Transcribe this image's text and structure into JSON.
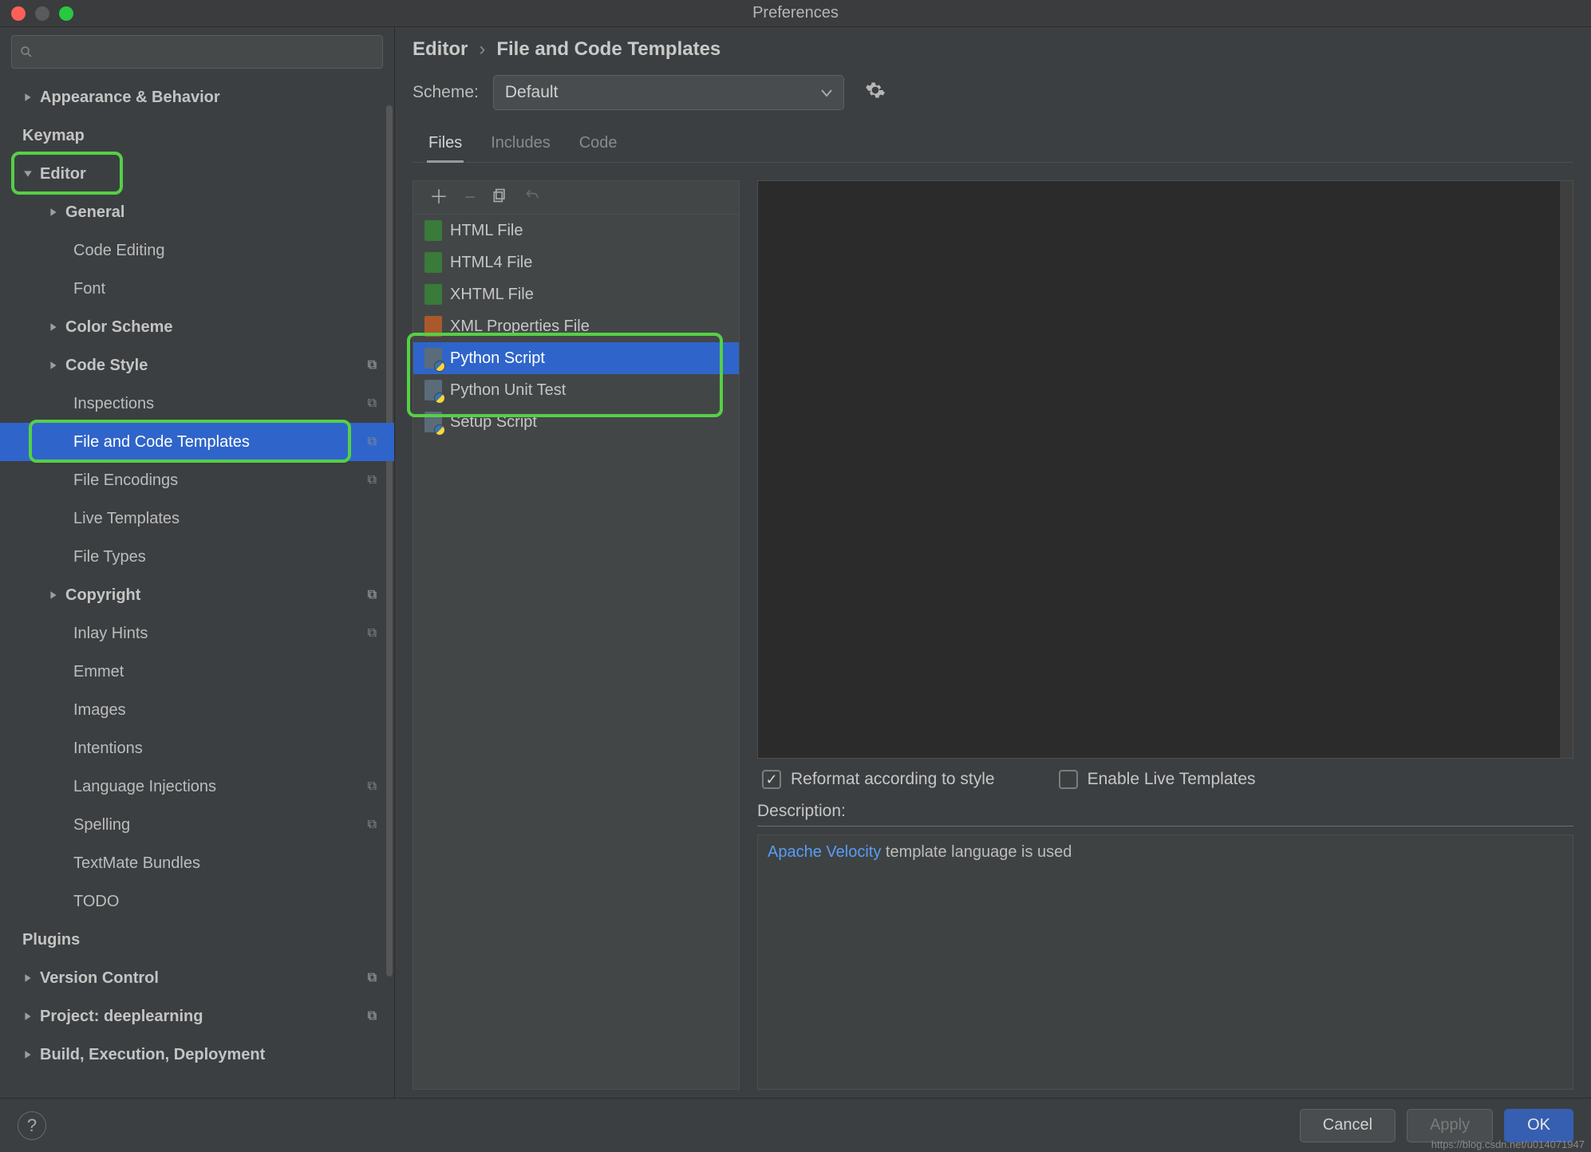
{
  "window": {
    "title": "Preferences"
  },
  "search": {
    "placeholder": ""
  },
  "sidebar": {
    "items": [
      {
        "label": "Appearance & Behavior",
        "level": 0,
        "arrow": "right"
      },
      {
        "label": "Keymap",
        "level": 0
      },
      {
        "label": "Editor",
        "level": 0,
        "arrow": "down",
        "highlight": true
      },
      {
        "label": "General",
        "level": 1,
        "arrow": "right"
      },
      {
        "label": "Code Editing",
        "level": 2
      },
      {
        "label": "Font",
        "level": 2
      },
      {
        "label": "Color Scheme",
        "level": 1,
        "arrow": "right"
      },
      {
        "label": "Code Style",
        "level": 1,
        "arrow": "right",
        "override": true
      },
      {
        "label": "Inspections",
        "level": 2,
        "override": true
      },
      {
        "label": "File and Code Templates",
        "level": 2,
        "selected": true,
        "override": true,
        "highlight": true
      },
      {
        "label": "File Encodings",
        "level": 2,
        "override": true
      },
      {
        "label": "Live Templates",
        "level": 2
      },
      {
        "label": "File Types",
        "level": 2
      },
      {
        "label": "Copyright",
        "level": 1,
        "arrow": "right",
        "override": true
      },
      {
        "label": "Inlay Hints",
        "level": 2,
        "override": true
      },
      {
        "label": "Emmet",
        "level": 2
      },
      {
        "label": "Images",
        "level": 2
      },
      {
        "label": "Intentions",
        "level": 2
      },
      {
        "label": "Language Injections",
        "level": 2,
        "override": true
      },
      {
        "label": "Spelling",
        "level": 2,
        "override": true
      },
      {
        "label": "TextMate Bundles",
        "level": 2
      },
      {
        "label": "TODO",
        "level": 2
      },
      {
        "label": "Plugins",
        "level": 0
      },
      {
        "label": "Version Control",
        "level": 0,
        "arrow": "right",
        "override": true
      },
      {
        "label": "Project: deeplearning",
        "level": 0,
        "arrow": "right",
        "override": true
      },
      {
        "label": "Build, Execution, Deployment",
        "level": 0,
        "arrow": "right"
      }
    ]
  },
  "breadcrumb": {
    "a": "Editor",
    "b": "File and Code Templates"
  },
  "scheme": {
    "label": "Scheme:",
    "value": "Default"
  },
  "tabs": [
    {
      "label": "Files",
      "active": true
    },
    {
      "label": "Includes"
    },
    {
      "label": "Code"
    }
  ],
  "templates": [
    {
      "label": "HTML File",
      "kind": "html"
    },
    {
      "label": "HTML4 File",
      "kind": "html"
    },
    {
      "label": "XHTML File",
      "kind": "html"
    },
    {
      "label": "XML Properties File",
      "kind": "xml"
    },
    {
      "label": "Python Script",
      "kind": "py",
      "selected": true
    },
    {
      "label": "Python Unit Test",
      "kind": "py"
    },
    {
      "label": "Setup Script",
      "kind": "py"
    }
  ],
  "options": {
    "reformat": {
      "label": "Reformat according to style",
      "checked": true
    },
    "live": {
      "label": "Enable Live Templates",
      "checked": false
    }
  },
  "description": {
    "label": "Description:",
    "link": "Apache Velocity",
    "suffix": " template language is used"
  },
  "buttons": {
    "cancel": "Cancel",
    "apply": "Apply",
    "ok": "OK"
  },
  "watermark": "https://blog.csdn.net/u014071947"
}
